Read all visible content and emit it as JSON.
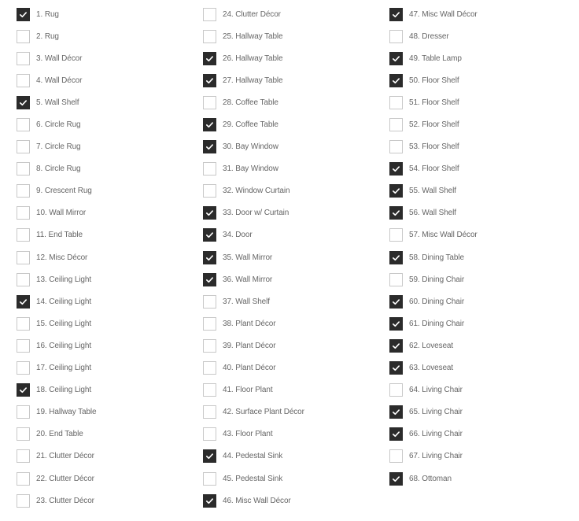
{
  "colors": {
    "checked_fill": "#2b2b2b",
    "unchecked_border": "#c8c8c8",
    "label_text": "#666666"
  },
  "items": [
    {
      "label": "1. Rug",
      "checked": true
    },
    {
      "label": "2. Rug",
      "checked": false
    },
    {
      "label": "3. Wall Décor",
      "checked": false
    },
    {
      "label": "4. Wall Décor",
      "checked": false
    },
    {
      "label": "5. Wall Shelf",
      "checked": true
    },
    {
      "label": "6. Circle Rug",
      "checked": false
    },
    {
      "label": "7. Circle Rug",
      "checked": false
    },
    {
      "label": "8. Circle Rug",
      "checked": false
    },
    {
      "label": "9. Crescent Rug",
      "checked": false
    },
    {
      "label": "10. Wall Mirror",
      "checked": false
    },
    {
      "label": "11. End Table",
      "checked": false
    },
    {
      "label": "12. Misc Décor",
      "checked": false
    },
    {
      "label": "13. Ceiling Light",
      "checked": false
    },
    {
      "label": "14. Ceiling Light",
      "checked": true
    },
    {
      "label": "15. Ceiling Light",
      "checked": false
    },
    {
      "label": "16. Ceiling Light",
      "checked": false
    },
    {
      "label": "17. Ceiling Light",
      "checked": false
    },
    {
      "label": "18. Ceiling Light",
      "checked": true
    },
    {
      "label": "19. Hallway Table",
      "checked": false
    },
    {
      "label": "20. End Table",
      "checked": false
    },
    {
      "label": "21. Clutter Décor",
      "checked": false
    },
    {
      "label": "22. Clutter Décor",
      "checked": false
    },
    {
      "label": "23. Clutter Décor",
      "checked": false
    },
    {
      "label": "24. Clutter Décor",
      "checked": false
    },
    {
      "label": "25. Hallway Table",
      "checked": false
    },
    {
      "label": "26. Hallway Table",
      "checked": true
    },
    {
      "label": "27. Hallway Table",
      "checked": true
    },
    {
      "label": "28. Coffee Table",
      "checked": false
    },
    {
      "label": "29. Coffee Table",
      "checked": true
    },
    {
      "label": "30. Bay Window",
      "checked": true
    },
    {
      "label": "31. Bay Window",
      "checked": false
    },
    {
      "label": "32. Window Curtain",
      "checked": false
    },
    {
      "label": "33. Door w/ Curtain",
      "checked": true
    },
    {
      "label": "34. Door",
      "checked": true
    },
    {
      "label": "35. Wall Mirror",
      "checked": true
    },
    {
      "label": "36. Wall Mirror",
      "checked": true
    },
    {
      "label": "37. Wall Shelf",
      "checked": false
    },
    {
      "label": "38. Plant Décor",
      "checked": false
    },
    {
      "label": "39. Plant Décor",
      "checked": false
    },
    {
      "label": "40. Plant Décor",
      "checked": false
    },
    {
      "label": "41. Floor Plant",
      "checked": false
    },
    {
      "label": "42. Surface Plant Décor",
      "checked": false
    },
    {
      "label": "43. Floor Plant",
      "checked": false
    },
    {
      "label": "44. Pedestal Sink",
      "checked": true
    },
    {
      "label": "45. Pedestal Sink",
      "checked": false
    },
    {
      "label": "46. Misc Wall Décor",
      "checked": true
    },
    {
      "label": "47. Misc Wall Décor",
      "checked": true
    },
    {
      "label": "48. Dresser",
      "checked": false
    },
    {
      "label": "49. Table Lamp",
      "checked": true
    },
    {
      "label": "50. Floor Shelf",
      "checked": true
    },
    {
      "label": "51. Floor Shelf",
      "checked": false
    },
    {
      "label": "52. Floor Shelf",
      "checked": false
    },
    {
      "label": "53. Floor Shelf",
      "checked": false
    },
    {
      "label": "54. Floor Shelf",
      "checked": true
    },
    {
      "label": "55. Wall Shelf",
      "checked": true
    },
    {
      "label": "56. Wall Shelf",
      "checked": true
    },
    {
      "label": "57. Misc Wall Décor",
      "checked": false
    },
    {
      "label": "58. Dining Table",
      "checked": true
    },
    {
      "label": "59. Dining Chair",
      "checked": false
    },
    {
      "label": "60. Dining Chair",
      "checked": true
    },
    {
      "label": "61. Dining Chair",
      "checked": true
    },
    {
      "label": "62. Loveseat",
      "checked": true
    },
    {
      "label": "63. Loveseat",
      "checked": true
    },
    {
      "label": "64. Living Chair",
      "checked": false
    },
    {
      "label": "65. Living Chair",
      "checked": true
    },
    {
      "label": "66. Living Chair",
      "checked": true
    },
    {
      "label": "67. Living Chair",
      "checked": false
    },
    {
      "label": "68. Ottoman",
      "checked": true
    }
  ]
}
